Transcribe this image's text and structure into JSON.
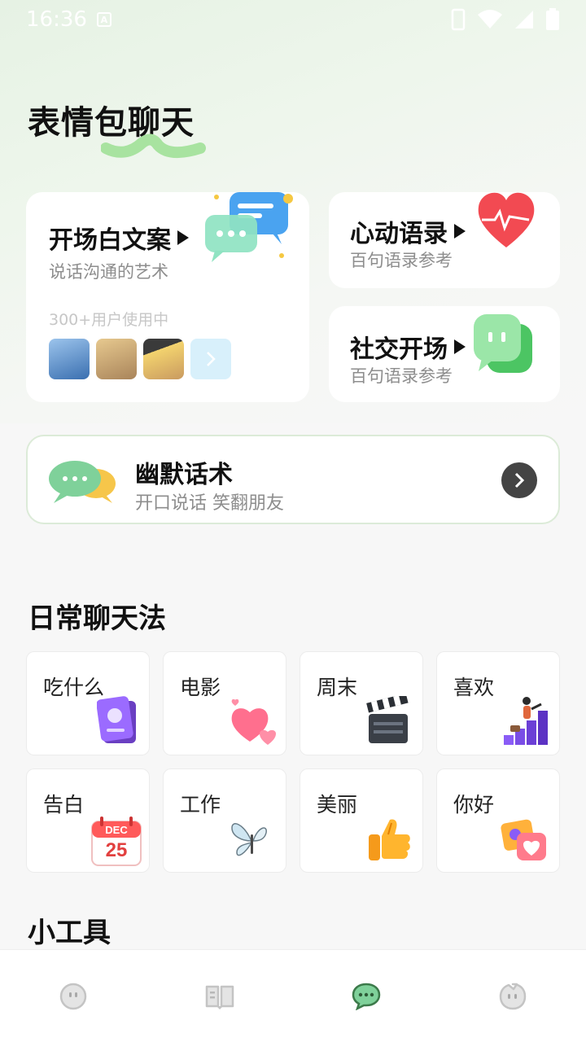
{
  "status_bar": {
    "time": "16:36",
    "a_badge": "A"
  },
  "page": {
    "title": "表情包聊天"
  },
  "cards": {
    "opening": {
      "title": "开场白文案",
      "subtitle": "说话沟通的艺术",
      "users": "300+用户使用中"
    },
    "heartbeat": {
      "title": "心动语录",
      "subtitle": "百句语录参考"
    },
    "social": {
      "title": "社交开场",
      "subtitle": "百句语录参考"
    }
  },
  "humor": {
    "title": "幽默话术",
    "subtitle": "开口说话 笑翻朋友"
  },
  "daily": {
    "title": "日常聊天法",
    "tiles": [
      {
        "label": "吃什么",
        "icon": "menu-book-icon"
      },
      {
        "label": "电影",
        "icon": "hearts-icon"
      },
      {
        "label": "周末",
        "icon": "clapperboard-icon"
      },
      {
        "label": "喜欢",
        "icon": "growth-chart-icon"
      },
      {
        "label": "告白",
        "icon": "calendar-icon"
      },
      {
        "label": "工作",
        "icon": "butterfly-icon"
      },
      {
        "label": "美丽",
        "icon": "thumbs-up-icon"
      },
      {
        "label": "你好",
        "icon": "photo-heart-icon"
      }
    ],
    "calendar": {
      "month": "DEC",
      "day": "25"
    }
  },
  "tools": {
    "title": "小工具"
  },
  "bottom_nav": [
    "face-icon",
    "book-icon",
    "chat-icon",
    "profile-icon"
  ],
  "colors": {
    "accent": "#3c9b4a",
    "nav_inactive": "#c4c4c4"
  }
}
